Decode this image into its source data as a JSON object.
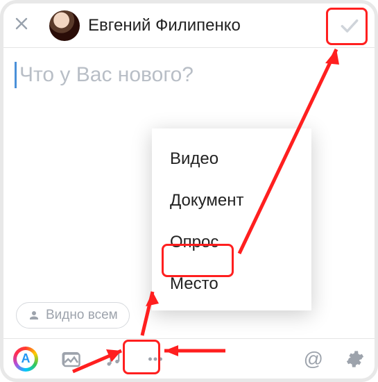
{
  "header": {
    "user_name": "Евгений Филипенко"
  },
  "composer": {
    "placeholder": "Что у Вас нового?"
  },
  "visibility": {
    "label": "Видно всем"
  },
  "menu": {
    "items": [
      "Видео",
      "Документ",
      "Опрос",
      "Место"
    ]
  },
  "toolbar": {
    "story_letter": "A",
    "mention_glyph": "@"
  }
}
